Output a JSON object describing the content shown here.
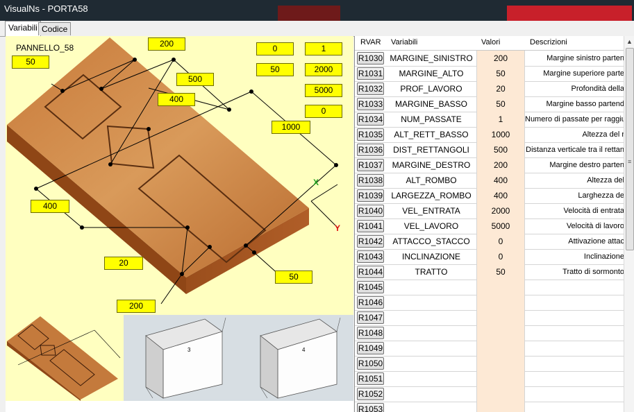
{
  "window": {
    "title": "VisualNs - PORTA58"
  },
  "tabs": [
    {
      "label": "Variabili"
    },
    {
      "label": "Codice"
    }
  ],
  "drawing": {
    "panel_label": "PANNELLO_58",
    "axis_x": "X",
    "axis_y": "Y",
    "dims": {
      "d50a": "50",
      "d200a": "200",
      "d500": "500",
      "d400a": "400",
      "d1000": "1000",
      "d400b": "400",
      "d20": "20",
      "d50b": "50",
      "d200b": "200"
    },
    "summary": {
      "s0a": "0",
      "s1": "1",
      "s50": "50",
      "s2000": "2000",
      "s5000": "5000",
      "s0b": "0"
    }
  },
  "thumbs": {
    "box3": "3",
    "box4": "4"
  },
  "grid": {
    "headers": {
      "rvar": "RVAR",
      "variabili": "Variabili",
      "valori": "Valori",
      "descrizioni": "Descrizioni"
    },
    "rows": [
      {
        "rvar": "R1030",
        "name": "MARGINE_SINISTRO",
        "value": "200",
        "desc": "Margine sinistro parten"
      },
      {
        "rvar": "R1031",
        "name": "MARGINE_ALTO",
        "value": "50",
        "desc": "Margine superiore parte"
      },
      {
        "rvar": "R1032",
        "name": "PROF_LAVORO",
        "value": "20",
        "desc": "Profondità della"
      },
      {
        "rvar": "R1033",
        "name": "MARGINE_BASSO",
        "value": "50",
        "desc": "Margine basso partend"
      },
      {
        "rvar": "R1034",
        "name": "NUM_PASSATE",
        "value": "1",
        "desc": "Numero di passate per raggiu"
      },
      {
        "rvar": "R1035",
        "name": "ALT_RETT_BASSO",
        "value": "1000",
        "desc": "Altezza del r"
      },
      {
        "rvar": "R1036",
        "name": "DIST_RETTANGOLI",
        "value": "500",
        "desc": "Distanza verticale tra il rettan"
      },
      {
        "rvar": "R1037",
        "name": "MARGINE_DESTRO",
        "value": "200",
        "desc": "Margine destro parten"
      },
      {
        "rvar": "R1038",
        "name": "ALT_ROMBO",
        "value": "400",
        "desc": "Altezza del"
      },
      {
        "rvar": "R1039",
        "name": "LARGEZZA_ROMBO",
        "value": "400",
        "desc": "Larghezza de"
      },
      {
        "rvar": "R1040",
        "name": "VEL_ENTRATA",
        "value": "2000",
        "desc": "Velocità di entrata"
      },
      {
        "rvar": "R1041",
        "name": "VEL_LAVORO",
        "value": "5000",
        "desc": "Velocità di lavoro"
      },
      {
        "rvar": "R1042",
        "name": "ATTACCO_STACCO",
        "value": "0",
        "desc": "Attivazione attac"
      },
      {
        "rvar": "R1043",
        "name": "INCLINAZIONE",
        "value": "0",
        "desc": "Inclinazione"
      },
      {
        "rvar": "R1044",
        "name": "TRATTO",
        "value": "50",
        "desc": "Tratto di sormonto"
      },
      {
        "rvar": "R1045",
        "name": "",
        "value": "",
        "desc": ""
      },
      {
        "rvar": "R1046",
        "name": "",
        "value": "",
        "desc": ""
      },
      {
        "rvar": "R1047",
        "name": "",
        "value": "",
        "desc": ""
      },
      {
        "rvar": "R1048",
        "name": "",
        "value": "",
        "desc": ""
      },
      {
        "rvar": "R1049",
        "name": "",
        "value": "",
        "desc": ""
      },
      {
        "rvar": "R1050",
        "name": "",
        "value": "",
        "desc": ""
      },
      {
        "rvar": "R1051",
        "name": "",
        "value": "",
        "desc": ""
      },
      {
        "rvar": "R1052",
        "name": "",
        "value": "",
        "desc": ""
      },
      {
        "rvar": "R1053",
        "name": "",
        "value": "",
        "desc": ""
      }
    ]
  }
}
